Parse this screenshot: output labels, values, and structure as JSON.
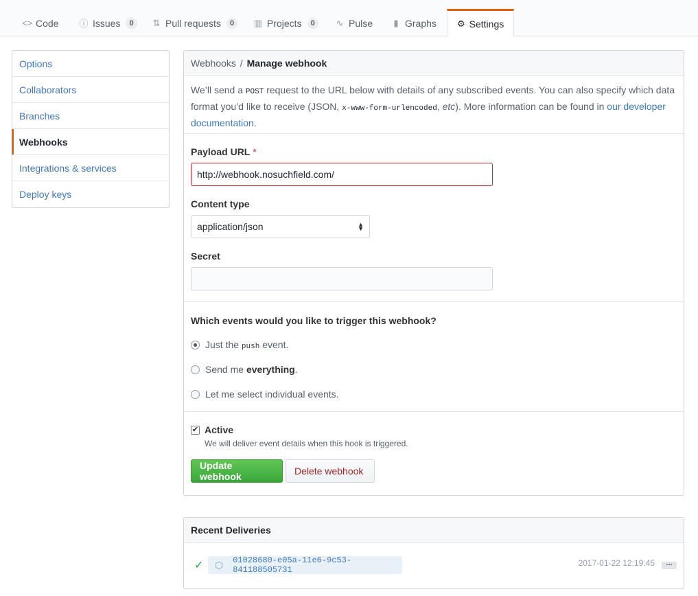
{
  "tabs": [
    {
      "label": "Code",
      "icon": "code-icon",
      "counter": null
    },
    {
      "label": "Issues",
      "icon": "issue-icon",
      "counter": "0"
    },
    {
      "label": "Pull requests",
      "icon": "pull-request-icon",
      "counter": "0"
    },
    {
      "label": "Projects",
      "icon": "project-icon",
      "counter": "0"
    },
    {
      "label": "Pulse",
      "icon": "pulse-icon",
      "counter": null
    },
    {
      "label": "Graphs",
      "icon": "graph-icon",
      "counter": null
    },
    {
      "label": "Settings",
      "icon": "gear-icon",
      "counter": null,
      "selected": true
    }
  ],
  "sidebar": {
    "items": [
      {
        "label": "Options"
      },
      {
        "label": "Collaborators"
      },
      {
        "label": "Branches"
      },
      {
        "label": "Webhooks",
        "selected": true
      },
      {
        "label": "Integrations & services"
      },
      {
        "label": "Deploy keys"
      }
    ]
  },
  "webhook": {
    "breadcrumb_parent": "Webhooks",
    "breadcrumb_sep": "/",
    "breadcrumb_current": "Manage webhook",
    "intro": {
      "p1": "We’ll send a ",
      "code1": "POST",
      "p2": " request to the URL below with details of any subscribed events. You can also specify which data format you’d like to receive (JSON, ",
      "code2": "x-www-form-urlencoded",
      "p3": ", ",
      "em": "etc",
      "p4": "). More information can be found in ",
      "link": "our developer documentation",
      "p5": "."
    },
    "payload_label": "Payload URL",
    "required_mark": "*",
    "payload_value": "http://webhook.nosuchfield.com/",
    "content_type_label": "Content type",
    "content_type_value": "application/json",
    "secret_label": "Secret",
    "secret_value": "",
    "events_question": "Which events would you like to trigger this webhook?",
    "event_push_pre": "Just the ",
    "event_push_code": "push",
    "event_push_post": " event.",
    "event_everything_pre": "Send me ",
    "event_everything_bold": "everything",
    "event_everything_post": ".",
    "event_individual": "Let me select individual events.",
    "active_label": "Active",
    "active_note": "We will deliver event details when this hook is triggered.",
    "update_button": "Update webhook",
    "delete_button": "Delete webhook"
  },
  "deliveries": {
    "title": "Recent Deliveries",
    "items": [
      {
        "guid": "01028680-e05a-11e6-9c53-841188505731",
        "time": "2017-01-22 12:19:45",
        "status": "success"
      }
    ]
  },
  "colors": {
    "accent": "#e36209",
    "link": "#4078c0",
    "success": "#28a745",
    "danger": "#a42526"
  }
}
